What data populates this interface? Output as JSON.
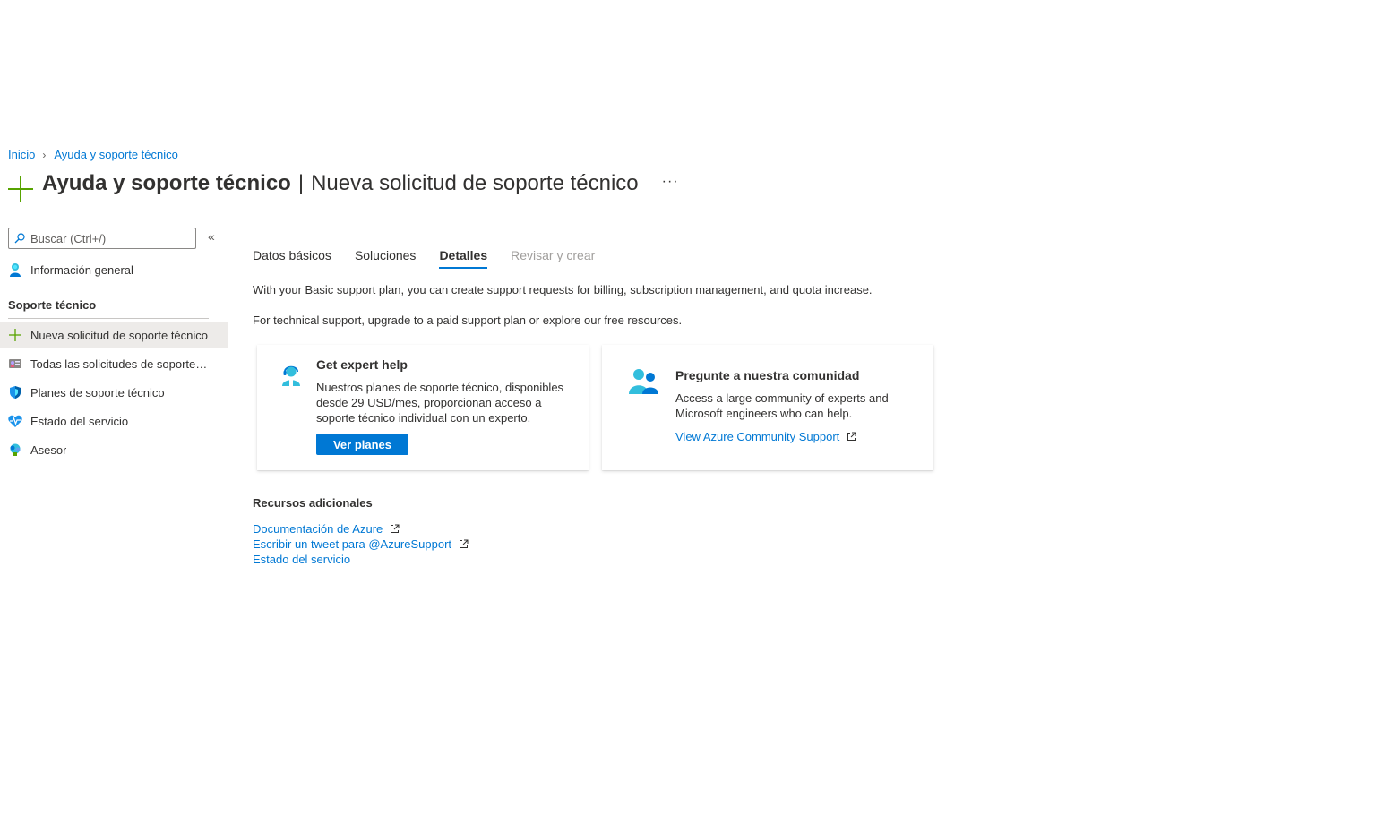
{
  "breadcrumb": {
    "items": [
      "Inicio",
      "Ayuda y soporte técnico"
    ]
  },
  "header": {
    "title": "Ayuda y soporte técnico",
    "separator": "|",
    "subtitle": "Nueva solicitud de soporte técnico",
    "more": "···"
  },
  "sidebar": {
    "search_placeholder": "Buscar (Ctrl+/)",
    "collapse": "«",
    "overview": "Información general",
    "section_title": "Soporte técnico",
    "items": [
      {
        "label": "Nueva solicitud de soporte técnico",
        "icon": "plus-icon",
        "active": true
      },
      {
        "label": "Todas las solicitudes de soporte técnico",
        "icon": "requests-icon"
      },
      {
        "label": "Planes de soporte técnico",
        "icon": "shield-icon"
      },
      {
        "label": "Estado del servicio",
        "icon": "heart-pulse-icon"
      },
      {
        "label": "Asesor",
        "icon": "advisor-icon"
      }
    ]
  },
  "tabs": [
    {
      "label": "Datos básicos",
      "state": "normal"
    },
    {
      "label": "Soluciones",
      "state": "normal"
    },
    {
      "label": "Detalles",
      "state": "active"
    },
    {
      "label": "Revisar y crear",
      "state": "disabled"
    }
  ],
  "info": {
    "line1": "With your Basic support plan, you can create support requests for billing, subscription management, and quota increase.",
    "line2": "For technical support, upgrade to a paid support plan or explore our free resources."
  },
  "cards": {
    "expert": {
      "title": "Get expert help",
      "description": "Nuestros planes de soporte técnico, disponibles desde 29 USD/mes, proporcionan acceso a soporte técnico individual con un experto.",
      "button": "Ver planes"
    },
    "community": {
      "title": "Pregunte a nuestra comunidad",
      "description": "Access a large community of experts and Microsoft engineers who can help.",
      "link": "View Azure Community Support"
    }
  },
  "resources": {
    "title": "Recursos adicionales",
    "links": [
      "Documentación de Azure",
      "Escribir un tweet para @AzureSupport",
      "Estado del servicio"
    ]
  },
  "colors": {
    "accent": "#0078d4",
    "plus_green": "#57a300",
    "text": "#323130",
    "disabled": "#a19f9d"
  }
}
